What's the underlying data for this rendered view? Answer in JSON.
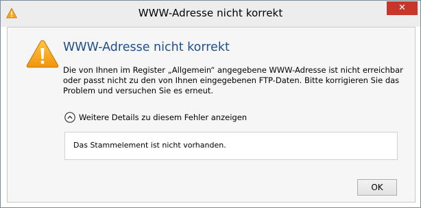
{
  "window": {
    "title": "WWW-Adresse nicht korrekt",
    "close_label": "✕",
    "title_icon": "warning-icon"
  },
  "dialog": {
    "icon": "warning-icon",
    "heading": "WWW-Adresse nicht korrekt",
    "message": "Die von Ihnen im Register „Allgemein“ angegebene WWW-Adresse ist nicht erreichbar oder passt nicht zu den von Ihnen eingegebenen FTP-Daten. Bitte korrigieren Sie das Problem und versuchen Sie es erneut.",
    "details_toggle_label": "Weitere Details zu diesem Fehler anzeigen",
    "details_text": "Das Stammelement ist nicht vorhanden.",
    "ok_label": "OK"
  },
  "colors": {
    "heading": "#1f4f8a",
    "close_button": "#c7362b",
    "warning_fill": "#f5a81c"
  }
}
